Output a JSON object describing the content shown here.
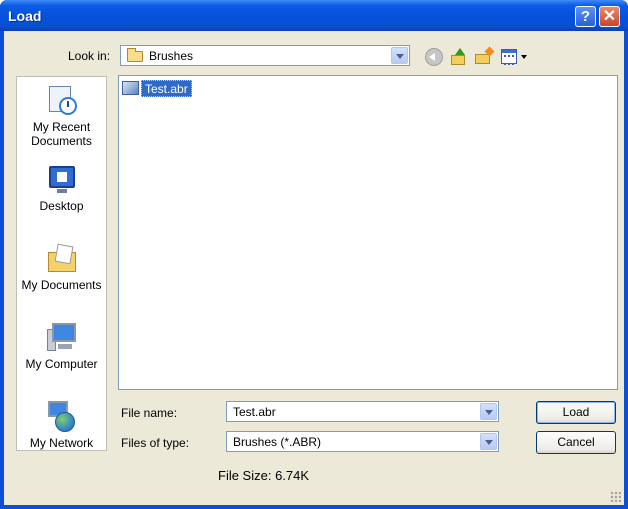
{
  "window": {
    "title": "Load"
  },
  "titlebar": {
    "help_label": "?",
    "close_label": "✕"
  },
  "toolbar": {
    "lookin_label": "Look in:",
    "lookin_value": "Brushes",
    "back_icon": "back-arrow-icon",
    "up_icon": "up-one-level-icon",
    "newfolder_icon": "new-folder-icon",
    "views_icon": "views-menu-icon"
  },
  "places": [
    {
      "label": "My Recent Documents",
      "icon": "recent-documents-icon"
    },
    {
      "label": "Desktop",
      "icon": "desktop-icon"
    },
    {
      "label": "My Documents",
      "icon": "my-documents-icon"
    },
    {
      "label": "My Computer",
      "icon": "my-computer-icon"
    },
    {
      "label": "My Network",
      "icon": "my-network-icon"
    }
  ],
  "files": [
    {
      "name": "Test.abr",
      "selected": true
    }
  ],
  "form": {
    "filename_label": "File name:",
    "filename_value": "Test.abr",
    "filetype_label": "Files of type:",
    "filetype_value": "Brushes (*.ABR)"
  },
  "buttons": {
    "load": "Load",
    "cancel": "Cancel"
  },
  "status": {
    "file_size": "File Size: 6.74K"
  },
  "colors": {
    "titlebar": "#0651d9",
    "selection": "#316ac5",
    "dialog_bg": "#ece9d8"
  }
}
